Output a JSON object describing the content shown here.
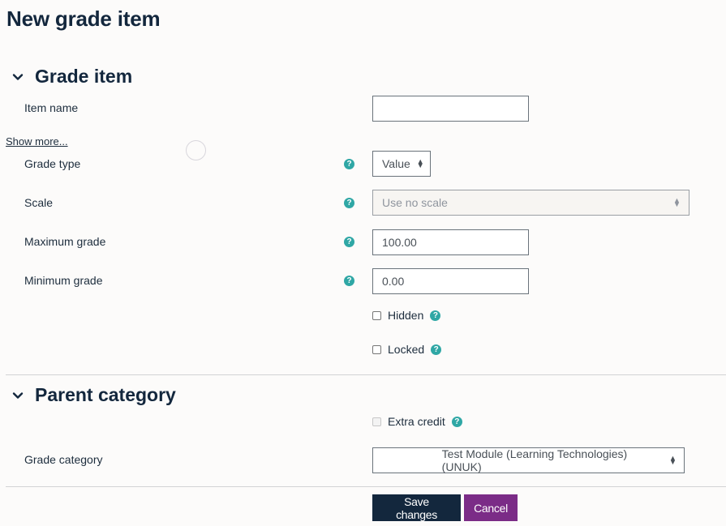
{
  "page": {
    "title": "New grade item"
  },
  "sections": {
    "grade_item": {
      "title": "Grade item",
      "icon": "chevron-down-icon"
    },
    "parent_category": {
      "title": "Parent category",
      "icon": "chevron-down-icon"
    }
  },
  "fields": {
    "item_name": {
      "label": "Item name",
      "value": "",
      "placeholder": ""
    },
    "show_more": {
      "label": "Show more..."
    },
    "grade_type": {
      "label": "Grade type",
      "value": "Value"
    },
    "scale": {
      "label": "Scale",
      "value": "Use no scale",
      "disabled": true
    },
    "maximum_grade": {
      "label": "Maximum grade",
      "value": "100.00"
    },
    "minimum_grade": {
      "label": "Minimum grade",
      "value": "0.00"
    },
    "hidden": {
      "label": "Hidden",
      "checked": false
    },
    "locked": {
      "label": "Locked",
      "checked": false
    },
    "extra_credit": {
      "label": "Extra credit",
      "checked": false,
      "disabled": true
    },
    "grade_category": {
      "label": "Grade category",
      "value": "Test Module (Learning Technologies) (UNUK)"
    }
  },
  "help_icon_glyph": "?",
  "buttons": {
    "save": "Save changes",
    "cancel": "Cancel"
  },
  "colors": {
    "primary": "#13273d",
    "cancel": "#7b2c87",
    "help": "#2fa7a5",
    "background": "#fcfbfa"
  }
}
